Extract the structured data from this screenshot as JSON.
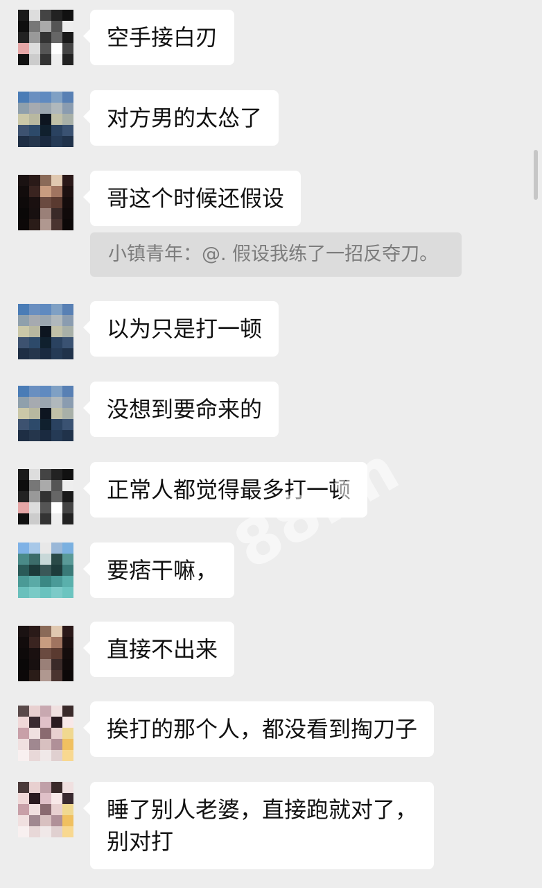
{
  "messages": [
    {
      "text": "空手接白刃",
      "avatar": "avatar-a"
    },
    {
      "text": "对方男的太怂了",
      "avatar": "avatar-b"
    },
    {
      "text": "哥这个时候还假设",
      "avatar": "avatar-c"
    },
    {
      "text": "以为只是打一顿",
      "avatar": "avatar-b"
    },
    {
      "text": "没想到要命来的",
      "avatar": "avatar-b"
    },
    {
      "text": "正常人都觉得最多打一顿",
      "avatar": "avatar-a"
    },
    {
      "text": "要痞干嘛，",
      "avatar": "avatar-d"
    },
    {
      "text": "直接不出来",
      "avatar": "avatar-c"
    },
    {
      "text": "挨打的那个人，都没看到掏刀子",
      "avatar": "avatar-e"
    },
    {
      "text_line1": "睡了别人老婆，直接跑就对了，",
      "text_line2": "别对打",
      "avatar": "avatar-e"
    }
  ],
  "quote": {
    "text": "小镇青年：@. 假设我练了一招反夺刀。"
  },
  "watermark": "88.m",
  "colors": {
    "background": "#ededed",
    "bubble": "#ffffff",
    "quote_bg": "#dcdcdc",
    "quote_text": "#7c7c7c"
  }
}
